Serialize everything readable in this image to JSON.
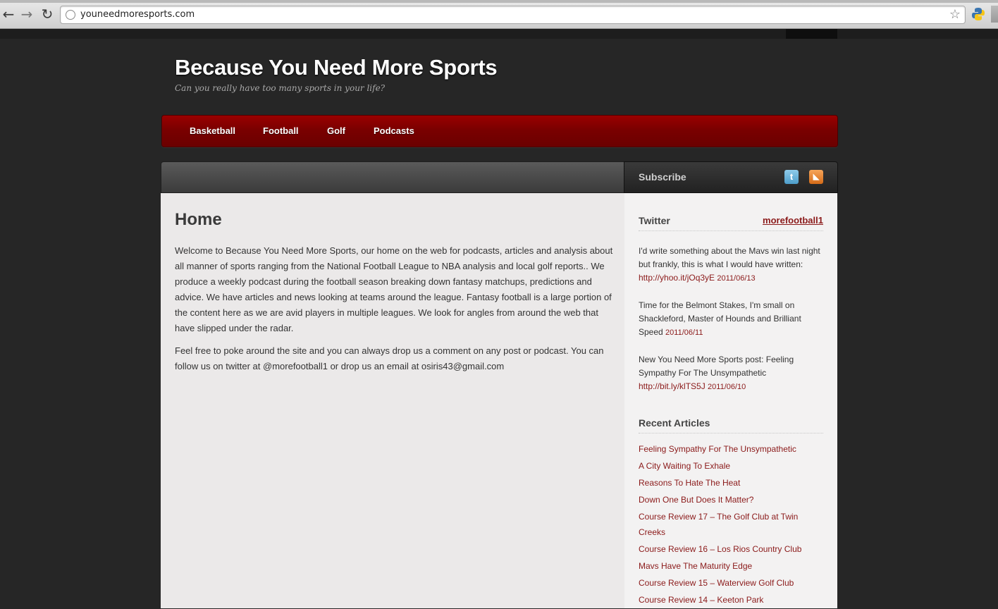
{
  "browser": {
    "url": "youneedmoresports.com",
    "back_glyph": "←",
    "forward_glyph": "→",
    "reload_glyph": "↻",
    "star_glyph": "☆"
  },
  "site": {
    "title": "Because You Need More Sports",
    "tagline": "Can you really have too many sports in your life?"
  },
  "nav": {
    "items": [
      {
        "label": "Basketball"
      },
      {
        "label": "Football"
      },
      {
        "label": "Golf"
      },
      {
        "label": "Podcasts"
      }
    ]
  },
  "subscribe": {
    "label": "Subscribe",
    "twitter_icon": "t",
    "rss_icon": "◣"
  },
  "main": {
    "title": "Home",
    "paragraphs": [
      "Welcome to Because You Need More Sports, our home on the web for podcasts, articles and analysis about all manner of sports ranging from the National Football League to NBA analysis and local golf reports.. We produce a weekly podcast during the football season breaking down fantasy matchups, predictions and advice. We have articles and news looking at teams around the league. Fantasy football is a large portion of the content here as we are avid players in multiple leagues. We look for angles from around the web that have slipped under the radar.",
      "Feel free to poke around the site and you can always drop us a comment on any post or podcast. You can follow us on twitter at @morefootball1 or drop us an email at osiris43@gmail.com"
    ]
  },
  "sidebar": {
    "twitter": {
      "title": "Twitter",
      "handle": "morefootball1",
      "tweets": [
        {
          "text": "I'd write something about the Mavs win last night but frankly, this is what I would have written: ",
          "link": "http://yhoo.it/jOq3yE",
          "date": "2011/06/13"
        },
        {
          "text": "Time for the Belmont Stakes, I'm small on Shackleford, Master of Hounds and Brilliant Speed ",
          "link": "",
          "date": "2011/06/11"
        },
        {
          "text": "New You Need More Sports post: Feeling Sympathy For The Unsympathetic ",
          "link": "http://bit.ly/klTS5J",
          "date": "2011/06/10"
        }
      ]
    },
    "recent_articles": {
      "title": "Recent Articles",
      "items": [
        {
          "label": "Feeling Sympathy For The Unsympathetic"
        },
        {
          "label": "A City Waiting To Exhale"
        },
        {
          "label": "Reasons To Hate The Heat"
        },
        {
          "label": "Down One But Does It Matter?"
        },
        {
          "label": "Course Review 17 – The Golf Club at Twin Creeks"
        },
        {
          "label": "Course Review 16 – Los Rios Country Club"
        },
        {
          "label": "Mavs Have The Maturity Edge"
        },
        {
          "label": "Course Review 15 – Waterview Golf Club"
        },
        {
          "label": "Course Review 14 – Keeton Park"
        }
      ]
    }
  },
  "colors": {
    "nav_red": "#8b0000",
    "link_red": "#8b1a1a",
    "page_bg": "#262626"
  }
}
